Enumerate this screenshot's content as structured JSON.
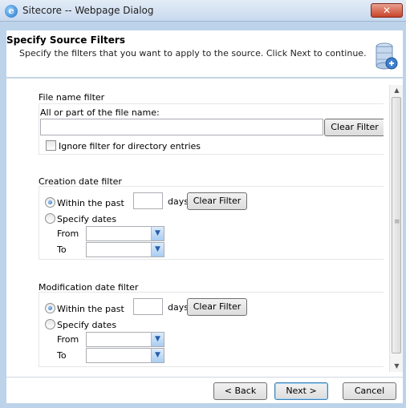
{
  "window": {
    "title": "Sitecore -- Webpage Dialog",
    "app_icon_glyph": "e",
    "close_glyph": "✕"
  },
  "header": {
    "title": "Specify Source Filters",
    "description": "Specify the filters that you want to apply to the source. Click Next to continue.",
    "graphic_icon": "database-wizard-icon"
  },
  "file_filter": {
    "section_label": "File name filter",
    "field_label": "All or part of the file name:",
    "value": "",
    "clear_label": "Clear Filter",
    "ignore_label": "Ignore filter for directory entries",
    "ignore_checked": false
  },
  "creation_filter": {
    "section_label": "Creation date filter",
    "within_label": "Within the past",
    "within_value": "",
    "days_label": "days",
    "clear_label": "Clear Filter",
    "specify_label": "Specify dates",
    "from_label": "From",
    "to_label": "To",
    "from_value": "",
    "to_value": "",
    "selected": "within"
  },
  "modification_filter": {
    "section_label": "Modification date filter",
    "within_label": "Within the past",
    "within_value": "",
    "days_label": "days",
    "clear_label": "Clear Filter",
    "specify_label": "Specify dates",
    "from_label": "From",
    "to_label": "To",
    "from_value": "",
    "to_value": "",
    "selected": "within"
  },
  "footer": {
    "back_label": "< Back",
    "next_label": "Next >",
    "cancel_label": "Cancel"
  },
  "scrollbar": {
    "up_glyph": "▲",
    "down_glyph": "▼",
    "grip_glyph": "≡"
  },
  "select_arrow_glyph": "▼"
}
